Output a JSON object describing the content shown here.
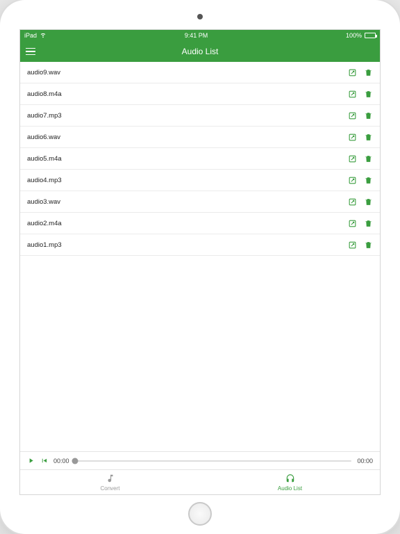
{
  "status": {
    "carrier": "iPad",
    "time": "9:41 PM",
    "battery": "100%"
  },
  "header": {
    "title": "Audio List"
  },
  "files": [
    {
      "name": "audio9.wav"
    },
    {
      "name": "audio8.m4a"
    },
    {
      "name": "audio7.mp3"
    },
    {
      "name": "audio6.wav"
    },
    {
      "name": "audio5.m4a"
    },
    {
      "name": "audio4.mp3"
    },
    {
      "name": "audio3.wav"
    },
    {
      "name": "audio2.m4a"
    },
    {
      "name": "audio1.mp3"
    }
  ],
  "player": {
    "elapsed": "00:00",
    "remaining": "00:00"
  },
  "tabs": {
    "convert": "Convert",
    "audio_list": "Audio List"
  },
  "colors": {
    "accent": "#3a9d3f"
  }
}
